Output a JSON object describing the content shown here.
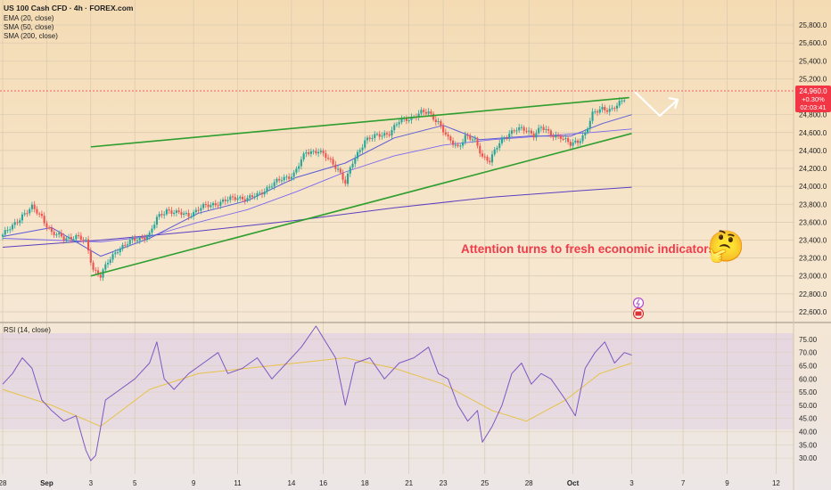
{
  "header": {
    "symbol_line": "US 100 Cash CFD · 4h · FOREX.com",
    "indicators": [
      "EMA (20, close)",
      "SMA (50, close)",
      "SMA (200, close)"
    ]
  },
  "price_badge": {
    "price": "24,960.0",
    "change": "+0.30%",
    "countdown": "02:03:41",
    "color": "#f23645"
  },
  "annotation": {
    "text": "Attention turns to fresh economic indicators",
    "color": "#ee3b4b",
    "emoji": "🤔"
  },
  "colors": {
    "up": "#26a69a",
    "down": "#ef5350",
    "trendline": "#2e9e2e",
    "ema": "#5b5bd6",
    "sma50": "#7b68ee",
    "sma200": "#5a3fc0",
    "rsi": "#7e57c2",
    "rsi_ma": "#e6c34a"
  },
  "rsi_panel": {
    "label": "RSI (14, close)"
  },
  "chart_data": [
    {
      "type": "candlestick",
      "title": "US 100 Cash CFD · 4h · FOREX.com",
      "x_tick_labels": [
        "28",
        "Sep",
        "3",
        "5",
        "9",
        "11",
        "14",
        "16",
        "18",
        "21",
        "23",
        "25",
        "28",
        "Oct",
        "3",
        "7",
        "9",
        "12"
      ],
      "y_tick_labels": [
        "25,800.0",
        "25,600.0",
        "25,400.0",
        "25,200.0",
        "24,800.0",
        "24,600.0",
        "24,400.0",
        "24,200.0",
        "24,000.0",
        "23,800.0",
        "23,600.0",
        "23,400.0",
        "23,200.0",
        "23,000.0",
        "22,800.0",
        "22,600.0"
      ],
      "ylim": [
        22560,
        25920
      ],
      "grid": true,
      "close_path": [
        [
          0,
          23460
        ],
        [
          4,
          23550
        ],
        [
          8,
          23680
        ],
        [
          12,
          23760
        ],
        [
          16,
          23660
        ],
        [
          20,
          23480
        ],
        [
          25,
          23420
        ],
        [
          30,
          23440
        ],
        [
          34,
          23380
        ],
        [
          37,
          23080
        ],
        [
          40,
          23000
        ],
        [
          43,
          23150
        ],
        [
          47,
          23300
        ],
        [
          52,
          23380
        ],
        [
          56,
          23420
        ],
        [
          60,
          23460
        ],
        [
          63,
          23640
        ],
        [
          67,
          23740
        ],
        [
          71,
          23700
        ],
        [
          76,
          23680
        ],
        [
          81,
          23760
        ],
        [
          86,
          23800
        ],
        [
          91,
          23840
        ],
        [
          96,
          23880
        ],
        [
          100,
          23860
        ],
        [
          104,
          23900
        ],
        [
          109,
          24000
        ],
        [
          114,
          24080
        ],
        [
          119,
          24140
        ],
        [
          124,
          24380
        ],
        [
          129,
          24400
        ],
        [
          133,
          24300
        ],
        [
          137,
          24200
        ],
        [
          140,
          24040
        ],
        [
          143,
          24260
        ],
        [
          148,
          24520
        ],
        [
          153,
          24560
        ],
        [
          158,
          24600
        ],
        [
          162,
          24720
        ],
        [
          166,
          24760
        ],
        [
          171,
          24820
        ],
        [
          174,
          24820
        ],
        [
          178,
          24720
        ],
        [
          182,
          24520
        ],
        [
          186,
          24440
        ],
        [
          189,
          24560
        ],
        [
          193,
          24500
        ],
        [
          196,
          24340
        ],
        [
          199,
          24290
        ],
        [
          203,
          24480
        ],
        [
          207,
          24600
        ],
        [
          210,
          24640
        ],
        [
          214,
          24620
        ],
        [
          217,
          24580
        ],
        [
          220,
          24660
        ],
        [
          224,
          24570
        ],
        [
          228,
          24560
        ],
        [
          232,
          24460
        ],
        [
          235,
          24500
        ],
        [
          238,
          24600
        ],
        [
          241,
          24800
        ],
        [
          245,
          24870
        ],
        [
          249,
          24860
        ],
        [
          252,
          24920
        ],
        [
          254,
          24960
        ]
      ],
      "series": [
        {
          "name": "EMA (20, close)",
          "points": [
            [
              0,
              23440
            ],
            [
              20,
              23540
            ],
            [
              40,
              23220
            ],
            [
              60,
              23420
            ],
            [
              80,
              23700
            ],
            [
              100,
              23840
            ],
            [
              120,
              24100
            ],
            [
              140,
              24260
            ],
            [
              160,
              24540
            ],
            [
              180,
              24680
            ],
            [
              195,
              24520
            ],
            [
              215,
              24560
            ],
            [
              232,
              24560
            ],
            [
              245,
              24700
            ],
            [
              257,
              24800
            ]
          ]
        },
        {
          "name": "SMA (50, close)",
          "points": [
            [
              0,
              23420
            ],
            [
              40,
              23380
            ],
            [
              60,
              23440
            ],
            [
              80,
              23600
            ],
            [
              100,
              23740
            ],
            [
              120,
              23940
            ],
            [
              140,
              24160
            ],
            [
              160,
              24340
            ],
            [
              180,
              24460
            ],
            [
              200,
              24520
            ],
            [
              220,
              24560
            ],
            [
              240,
              24600
            ],
            [
              257,
              24640
            ]
          ]
        },
        {
          "name": "SMA (200, close)",
          "points": [
            [
              0,
              23320
            ],
            [
              40,
              23400
            ],
            [
              80,
              23500
            ],
            [
              120,
              23620
            ],
            [
              160,
              23760
            ],
            [
              200,
              23880
            ],
            [
              240,
              23960
            ],
            [
              257,
              23990
            ]
          ]
        }
      ],
      "trendlines": [
        {
          "from": [
            36,
            24440
          ],
          "to": [
            256,
            24990
          ]
        },
        {
          "from": [
            36,
            23000
          ],
          "to": [
            257,
            24590
          ]
        }
      ]
    },
    {
      "type": "line",
      "title": "RSI (14, close)",
      "y_tick_labels": [
        "75.00",
        "70.00",
        "65.00",
        "60.00",
        "55.00",
        "50.00",
        "45.00",
        "40.00",
        "35.00",
        "30.00"
      ],
      "ylim": [
        27,
        79
      ],
      "series": [
        {
          "name": "RSI",
          "points": [
            [
              0,
              58
            ],
            [
              4,
              62
            ],
            [
              8,
              68
            ],
            [
              12,
              64
            ],
            [
              16,
              52
            ],
            [
              20,
              48
            ],
            [
              25,
              44
            ],
            [
              30,
              46
            ],
            [
              34,
              33
            ],
            [
              36,
              29
            ],
            [
              38,
              31
            ],
            [
              42,
              52
            ],
            [
              48,
              56
            ],
            [
              54,
              60
            ],
            [
              60,
              66
            ],
            [
              63,
              74
            ],
            [
              66,
              60
            ],
            [
              70,
              56
            ],
            [
              76,
              62
            ],
            [
              82,
              66
            ],
            [
              88,
              70
            ],
            [
              92,
              62
            ],
            [
              98,
              64
            ],
            [
              104,
              68
            ],
            [
              110,
              60
            ],
            [
              116,
              66
            ],
            [
              122,
              72
            ],
            [
              128,
              80
            ],
            [
              132,
              74
            ],
            [
              136,
              68
            ],
            [
              140,
              50
            ],
            [
              144,
              66
            ],
            [
              150,
              68
            ],
            [
              156,
              60
            ],
            [
              162,
              66
            ],
            [
              168,
              68
            ],
            [
              174,
              72
            ],
            [
              178,
              62
            ],
            [
              182,
              60
            ],
            [
              186,
              50
            ],
            [
              190,
              44
            ],
            [
              194,
              48
            ],
            [
              196,
              36
            ],
            [
              200,
              42
            ],
            [
              204,
              50
            ],
            [
              208,
              62
            ],
            [
              212,
              66
            ],
            [
              216,
              58
            ],
            [
              220,
              62
            ],
            [
              224,
              60
            ],
            [
              230,
              52
            ],
            [
              234,
              46
            ],
            [
              238,
              64
            ],
            [
              242,
              70
            ],
            [
              246,
              74
            ],
            [
              250,
              66
            ],
            [
              254,
              70
            ],
            [
              257,
              69
            ]
          ]
        },
        {
          "name": "RSI MA",
          "points": [
            [
              0,
              56
            ],
            [
              20,
              50
            ],
            [
              40,
              42
            ],
            [
              60,
              56
            ],
            [
              80,
              62
            ],
            [
              100,
              64
            ],
            [
              120,
              66
            ],
            [
              140,
              68
            ],
            [
              160,
              64
            ],
            [
              180,
              58
            ],
            [
              200,
              48
            ],
            [
              214,
              44
            ],
            [
              230,
              52
            ],
            [
              244,
              62
            ],
            [
              257,
              66
            ]
          ]
        }
      ]
    }
  ]
}
